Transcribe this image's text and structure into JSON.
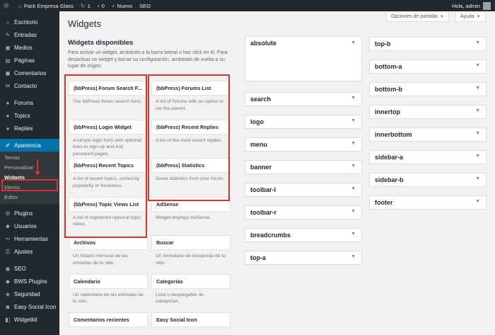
{
  "adminbar": {
    "site_name": "Pack Empresa Glass",
    "updates": "1",
    "comments": "0",
    "new_label": "Nuevo",
    "seo_label": "SEO",
    "greeting": "Hola, admin"
  },
  "sidebar": {
    "items": [
      {
        "label": "Escritorio",
        "icon": "dashboard-icon",
        "glyph": "⌂"
      },
      {
        "label": "Entradas",
        "icon": "pin-icon",
        "glyph": "✎"
      },
      {
        "label": "Medios",
        "icon": "media-icon",
        "glyph": "▣"
      },
      {
        "label": "Páginas",
        "icon": "pages-icon",
        "glyph": "▤"
      },
      {
        "label": "Comentarios",
        "icon": "comments-icon",
        "glyph": "◼"
      },
      {
        "label": "Contacto",
        "icon": "mail-icon",
        "glyph": "✉"
      },
      {
        "label": "Forums",
        "icon": "forums-icon",
        "glyph": "●"
      },
      {
        "label": "Topics",
        "icon": "topics-icon",
        "glyph": "●"
      },
      {
        "label": "Replies",
        "icon": "replies-icon",
        "glyph": "●"
      },
      {
        "label": "Apariencia",
        "icon": "appearance-icon",
        "glyph": "✐"
      },
      {
        "label": "Plugins",
        "icon": "plugins-icon",
        "glyph": "⚙"
      },
      {
        "label": "Usuarios",
        "icon": "users-icon",
        "glyph": "☻"
      },
      {
        "label": "Herramientas",
        "icon": "tools-icon",
        "glyph": "✂"
      },
      {
        "label": "Ajustes",
        "icon": "settings-icon",
        "glyph": "☰"
      },
      {
        "label": "SEO",
        "icon": "seo-icon",
        "glyph": "◉"
      },
      {
        "label": "BWS Plugins",
        "icon": "bws-icon",
        "glyph": "◆"
      },
      {
        "label": "Seguridad",
        "icon": "security-icon",
        "glyph": "◈"
      },
      {
        "label": "Easy Social Icon",
        "icon": "social-icon",
        "glyph": "◙"
      },
      {
        "label": "Widgetkit",
        "icon": "widgetkit-icon",
        "glyph": "◧"
      }
    ],
    "submenu": [
      "Temas",
      "Personalizar",
      "Widgets",
      "Menús",
      "Editor"
    ]
  },
  "header": {
    "screen_options": "Opciones de pantalla",
    "help": "Ayuda",
    "title": "Widgets"
  },
  "available": {
    "heading": "Widgets disponibles",
    "description": "Para activar un widget, arrástralo a la barra lateral o haz click en él. Para desactivar un widget y borrar su configuración, arrástralo de vuelta a su lugar de origen.",
    "widgets": [
      {
        "title": "(bbPress) Forum Search F...",
        "desc": "The bbPress forum search form."
      },
      {
        "title": "(bbPress) Forums List",
        "desc": "A list of forums with an option to set the parent."
      },
      {
        "title": "(bbPress) Login Widget",
        "desc": "A simple login form with optional links to sign-up and lost password pages."
      },
      {
        "title": "(bbPress) Recent Replies",
        "desc": "A list of the most recent replies."
      },
      {
        "title": "(bbPress) Recent Topics",
        "desc": "A list of recent topics, sorted by popularity or freshness."
      },
      {
        "title": "(bbPress) Statistics",
        "desc": "Some statistics from your forum."
      },
      {
        "title": "(bbPress) Topic Views List",
        "desc": "A list of registered optional topic views."
      },
      {
        "title": "AdSense",
        "desc": "Widget displays AdSense"
      },
      {
        "title": "Archivos",
        "desc": "Un listado mensual de las entradas de tu sitio."
      },
      {
        "title": "Buscar",
        "desc": "Un formulario de búsqueda de tu sitio."
      },
      {
        "title": "Calendario",
        "desc": "Un calendario de las entradas de tu sitio."
      },
      {
        "title": "Categorías",
        "desc": "Lista o desplegable de categorías."
      },
      {
        "title": "Comentarios recientes",
        "desc": ""
      },
      {
        "title": "Easy Social Icon",
        "desc": ""
      }
    ]
  },
  "areas_col1": [
    "absolute",
    "search",
    "logo",
    "menu",
    "banner",
    "toolbar-l",
    "toolbar-r",
    "breadcrumbs",
    "top-a"
  ],
  "areas_col2": [
    "top-b",
    "bottom-a",
    "bottom-b",
    "innertop",
    "innerbottom",
    "sidebar-a",
    "sidebar-b",
    "footer"
  ],
  "colors": {
    "accent": "#0073aa",
    "highlight": "#d9342b",
    "adminbar": "#23282d"
  }
}
